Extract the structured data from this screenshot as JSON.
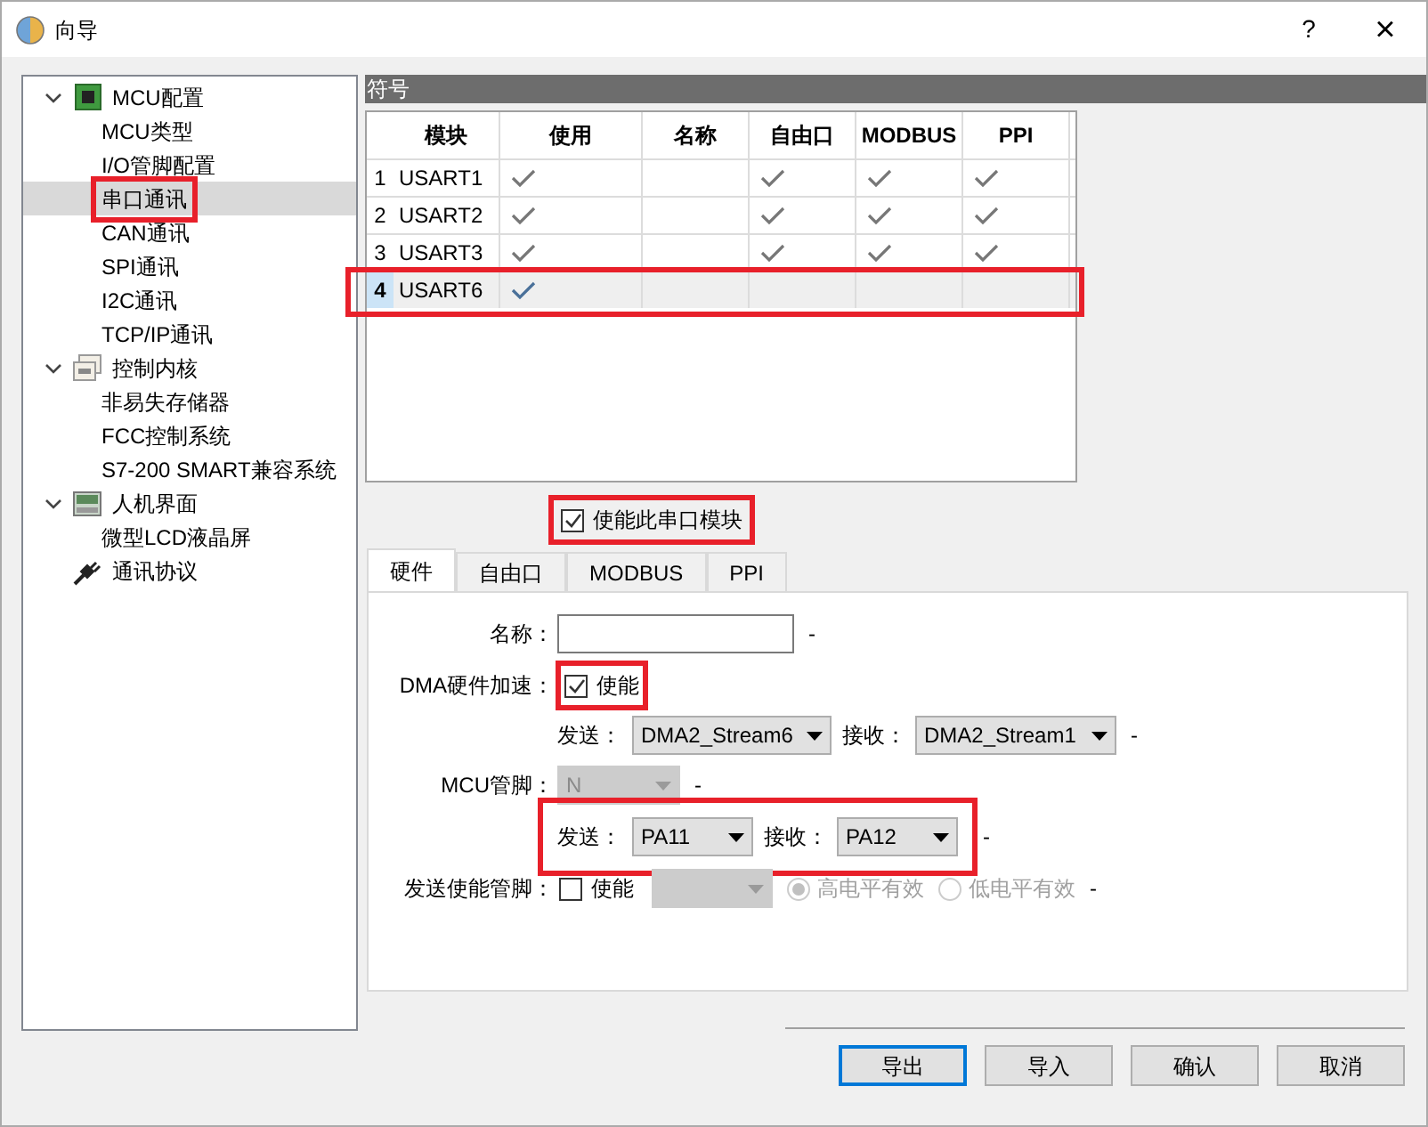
{
  "window": {
    "title": "向导",
    "help": "?",
    "close": "×"
  },
  "tree": [
    {
      "label": "MCU配置",
      "expanded": true,
      "selected": false,
      "children": [
        {
          "label": "MCU类型",
          "selected": false
        },
        {
          "label": "I/O管脚配置",
          "selected": false
        },
        {
          "label": "串口通讯",
          "selected": true,
          "highlighted": true
        },
        {
          "label": "CAN通讯",
          "selected": false
        },
        {
          "label": "SPI通讯",
          "selected": false
        },
        {
          "label": "I2C通讯",
          "selected": false
        },
        {
          "label": "TCP/IP通讯",
          "selected": false
        }
      ]
    },
    {
      "label": "控制内核",
      "expanded": true,
      "selected": false,
      "children": [
        {
          "label": "非易失存储器",
          "selected": false
        },
        {
          "label": "FCC控制系统",
          "selected": false
        },
        {
          "label": "S7-200 SMART兼容系统",
          "selected": false
        }
      ]
    },
    {
      "label": "人机界面",
      "expanded": true,
      "selected": false,
      "children": [
        {
          "label": "微型LCD液晶屏",
          "selected": false
        }
      ]
    },
    {
      "label": "通讯协议",
      "selected": false
    }
  ],
  "symbol_panel": {
    "title": "符号"
  },
  "table": {
    "columns": [
      "模块",
      "使用",
      "名称",
      "自由口",
      "MODBUS",
      "PPI"
    ],
    "rows": [
      {
        "index": "1",
        "module": "USART1",
        "used": true,
        "free_port": true,
        "modbus": true,
        "ppi": true,
        "selected": false
      },
      {
        "index": "2",
        "module": "USART2",
        "used": true,
        "free_port": true,
        "modbus": true,
        "ppi": true,
        "selected": false
      },
      {
        "index": "3",
        "module": "USART3",
        "used": true,
        "free_port": true,
        "modbus": true,
        "ppi": true,
        "selected": false
      },
      {
        "index": "4",
        "module": "USART6",
        "used": true,
        "free_port": false,
        "modbus": false,
        "ppi": false,
        "selected": true,
        "highlighted": true
      }
    ]
  },
  "enable_module": {
    "label": "使能此串口模块",
    "checked": true,
    "highlighted": true
  },
  "tabs": [
    {
      "label": "硬件",
      "selected": true
    },
    {
      "label": "自由口",
      "selected": false
    },
    {
      "label": "MODBUS",
      "selected": false
    },
    {
      "label": "PPI",
      "selected": false
    }
  ],
  "form": {
    "name": {
      "label": "名称：",
      "suffix": "-"
    },
    "dma": {
      "label": "DMA硬件加速：",
      "checkbox_label": "使能",
      "checked": true,
      "highlighted": true
    },
    "dma_streams": {
      "send_label": "发送：",
      "send_value": "DMA2_Stream6",
      "receive_label": "接收：",
      "receive_value": "DMA2_Stream1",
      "suffix": "-"
    },
    "mcu_pin": {
      "label": "MCU管脚：",
      "value": "N",
      "disabled": true,
      "suffix": "-"
    },
    "pins": {
      "send_label": "发送：",
      "send_value": "PA11",
      "receive_label": "接收：",
      "receive_value": "PA12",
      "suffix": "-",
      "highlighted": true
    },
    "tx_enable": {
      "label": "发送使能管脚：",
      "checkbox_label": "使能",
      "checked": false,
      "select_disabled": true,
      "options": [
        {
          "label": "高电平有效",
          "selected": true,
          "disabled": true
        },
        {
          "label": "低电平有效",
          "selected": false,
          "disabled": true
        }
      ],
      "suffix": "-"
    }
  },
  "buttons": [
    {
      "label": "导出",
      "focused": true
    },
    {
      "label": "导入",
      "focused": false
    },
    {
      "label": "确认",
      "focused": false
    },
    {
      "label": "取消",
      "focused": false
    }
  ]
}
